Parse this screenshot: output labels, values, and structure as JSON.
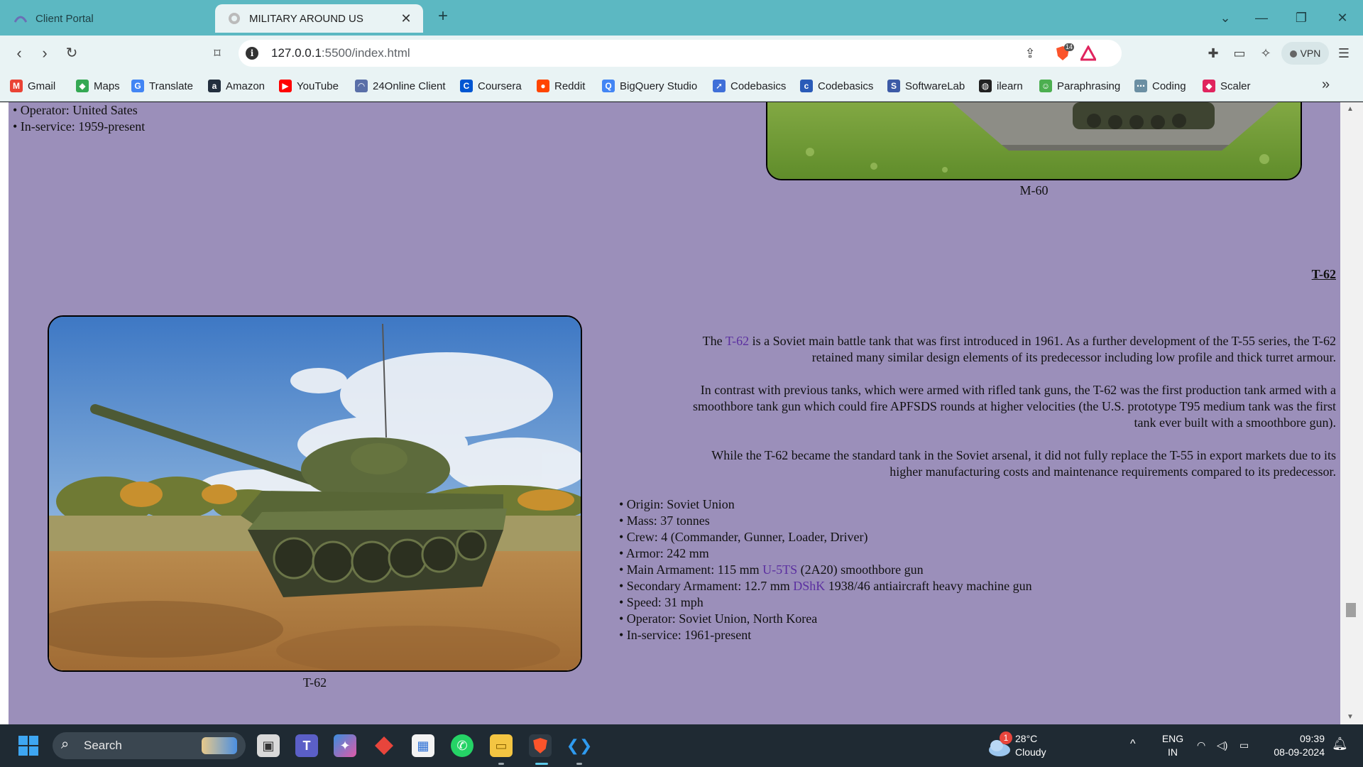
{
  "browser": {
    "tabs": [
      {
        "title": "Client Portal",
        "active": false
      },
      {
        "title": "MILITARY AROUND US",
        "active": true
      }
    ],
    "new_tab_glyph": "+",
    "close_glyph": "✕",
    "url_host": "127.0.0.1",
    "url_rest": ":5500/index.html",
    "shield_count": "14",
    "vpn_label": "VPN",
    "bookmarks": [
      {
        "label": "Gmail",
        "icon": "gmail-icon",
        "color": "#ea4335",
        "glyph": "M"
      },
      {
        "label": "Maps",
        "icon": "maps-icon",
        "color": "#34a853",
        "glyph": "◆"
      },
      {
        "label": "Translate",
        "icon": "translate-icon",
        "color": "#4285f4",
        "glyph": "G"
      },
      {
        "label": "Amazon",
        "icon": "amazon-icon",
        "color": "#232f3e",
        "glyph": "a"
      },
      {
        "label": "YouTube",
        "icon": "youtube-icon",
        "color": "#ff0000",
        "glyph": "▶"
      },
      {
        "label": "24Online Client",
        "icon": "24online-icon",
        "color": "#5a6fa8",
        "glyph": "◠"
      },
      {
        "label": "Coursera",
        "icon": "coursera-icon",
        "color": "#0056d2",
        "glyph": "C"
      },
      {
        "label": "Reddit",
        "icon": "reddit-icon",
        "color": "#ff4500",
        "glyph": "●"
      },
      {
        "label": "BigQuery Studio",
        "icon": "bigquery-icon",
        "color": "#4285f4",
        "glyph": "Q"
      },
      {
        "label": "Codebasics",
        "icon": "rocket-icon",
        "color": "#3f6fd8",
        "glyph": "➚"
      },
      {
        "label": "Codebasics",
        "icon": "codebasics-icon",
        "color": "#2a5bb8",
        "glyph": "c"
      },
      {
        "label": "SoftwareLab",
        "icon": "softwarelab-icon",
        "color": "#3c5aa6",
        "glyph": "S"
      },
      {
        "label": "ilearn",
        "icon": "globe-icon",
        "color": "#222222",
        "glyph": "◍"
      },
      {
        "label": "Paraphrasing",
        "icon": "paraphrasing-icon",
        "color": "#4caf50",
        "glyph": "☺"
      },
      {
        "label": "Coding",
        "icon": "coding-icon",
        "color": "#6b8fa3",
        "glyph": "⋯"
      },
      {
        "label": "Scaler",
        "icon": "scaler-icon",
        "color": "#e0245e",
        "glyph": "◆"
      }
    ]
  },
  "page": {
    "m60_tail": {
      "operator": "• Operator: United Sates",
      "in_service": "• In-service: 1959-present",
      "caption": "M-60"
    },
    "t62": {
      "heading": "T-62",
      "p1_pre": "The ",
      "p1_link": "T-62",
      "p1_post_line1": " is a Soviet main battle tank that was first introduced in 1961. As a further development of the T-55 series, the T-62",
      "p1_line2": "retained many similar design elements of its predecessor including low profile and thick turret armour.",
      "p2_line1": "In contrast with previous tanks, which were armed with rifled tank guns, the T-62 was the first production tank armed with a",
      "p2_line2": "smoothbore tank gun which could fire APFSDS rounds at higher velocities (the U.S. prototype T95 medium tank was the first",
      "p2_line3": "tank ever built with a smoothbore gun).",
      "p3_line1": "While the T-62 became the standard tank in the Soviet arsenal, it did not fully replace the T-55 in export markets due to its",
      "p3_line2": "higher manufacturing costs and maintenance requirements compared to its predecessor.",
      "specs": {
        "origin": "• Origin: Soviet Union",
        "mass": "• Mass: 37 tonnes",
        "crew": "• Crew: 4 (Commander, Gunner, Loader, Driver)",
        "armor": "• Armor: 242 mm",
        "main_pre": "• Main Armament: 115 mm ",
        "main_link": "U-5TS",
        "main_post": " (2A20) smoothbore gun",
        "secondary_pre": "• Secondary Armament: 12.7 mm ",
        "secondary_link": "DShK",
        "secondary_post": " 1938/46 antiaircraft heavy machine gun",
        "speed": "• Speed: 31 mph",
        "operator": "• Operator: Soviet Union, North Korea",
        "in_service": "• In-service: 1961-present"
      },
      "caption": "T-62"
    }
  },
  "taskbar": {
    "search_label": "Search",
    "weather_badge": "1",
    "weather_temp": "28°C",
    "weather_desc": "Cloudy",
    "lang_top": "ENG",
    "lang_bottom": "IN",
    "time": "09:39",
    "date": "08-09-2024"
  },
  "colors": {
    "tabstrip": "#5cb8c2",
    "toolbar": "#e9f3f4",
    "page_background": "#9b8fba",
    "link": "#5b2fa0",
    "taskbar": "#1f2a33"
  }
}
